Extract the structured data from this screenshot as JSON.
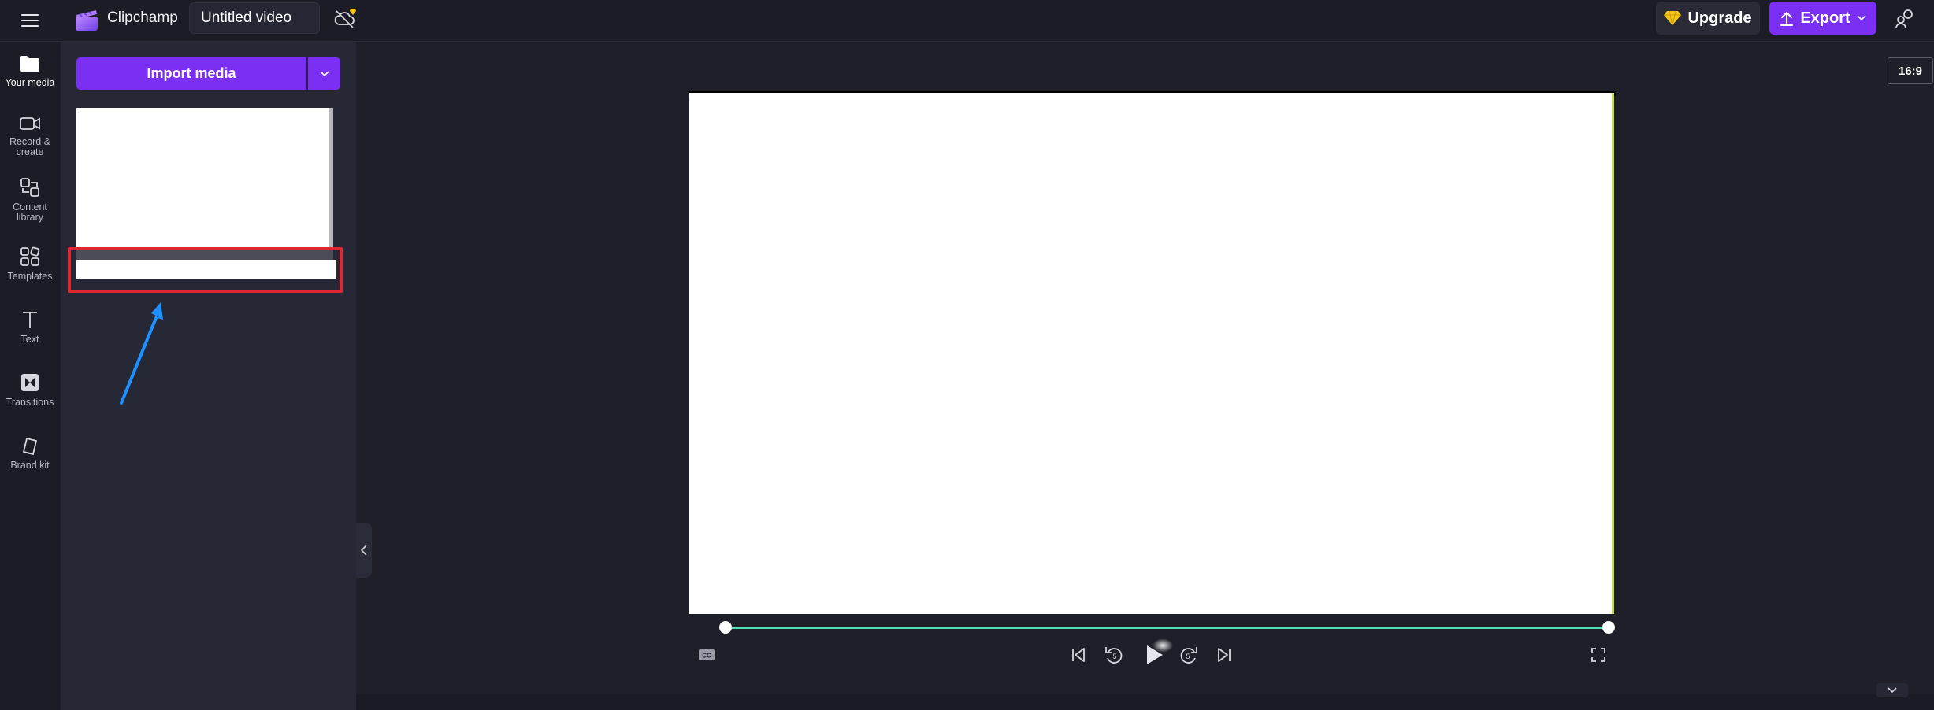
{
  "header": {
    "app_name": "Clipchamp",
    "project_title": "Untitled video",
    "upgrade_label": "Upgrade",
    "export_label": "Export"
  },
  "nav": {
    "items": [
      {
        "label": "Your media",
        "icon": "folder-icon",
        "active": true
      },
      {
        "label": "Record & create",
        "icon": "camera-icon"
      },
      {
        "label": "Content library",
        "icon": "content-library-icon"
      },
      {
        "label": "Templates",
        "icon": "templates-icon"
      },
      {
        "label": "Text",
        "icon": "text-icon"
      },
      {
        "label": "Transitions",
        "icon": "transitions-icon"
      },
      {
        "label": "Brand kit",
        "icon": "brand-kit-icon"
      }
    ]
  },
  "media_panel": {
    "import_label": "Import media"
  },
  "preview": {
    "aspect_ratio": "16:9",
    "skip_back_seconds": "5",
    "skip_forward_seconds": "5"
  },
  "colors": {
    "accent": "#7b2ff2",
    "highlight": "#e0262e",
    "annotation_arrow": "#1e90ff",
    "scrubber": "#4fe0b8",
    "upgrade_gem": "#f5c518"
  }
}
